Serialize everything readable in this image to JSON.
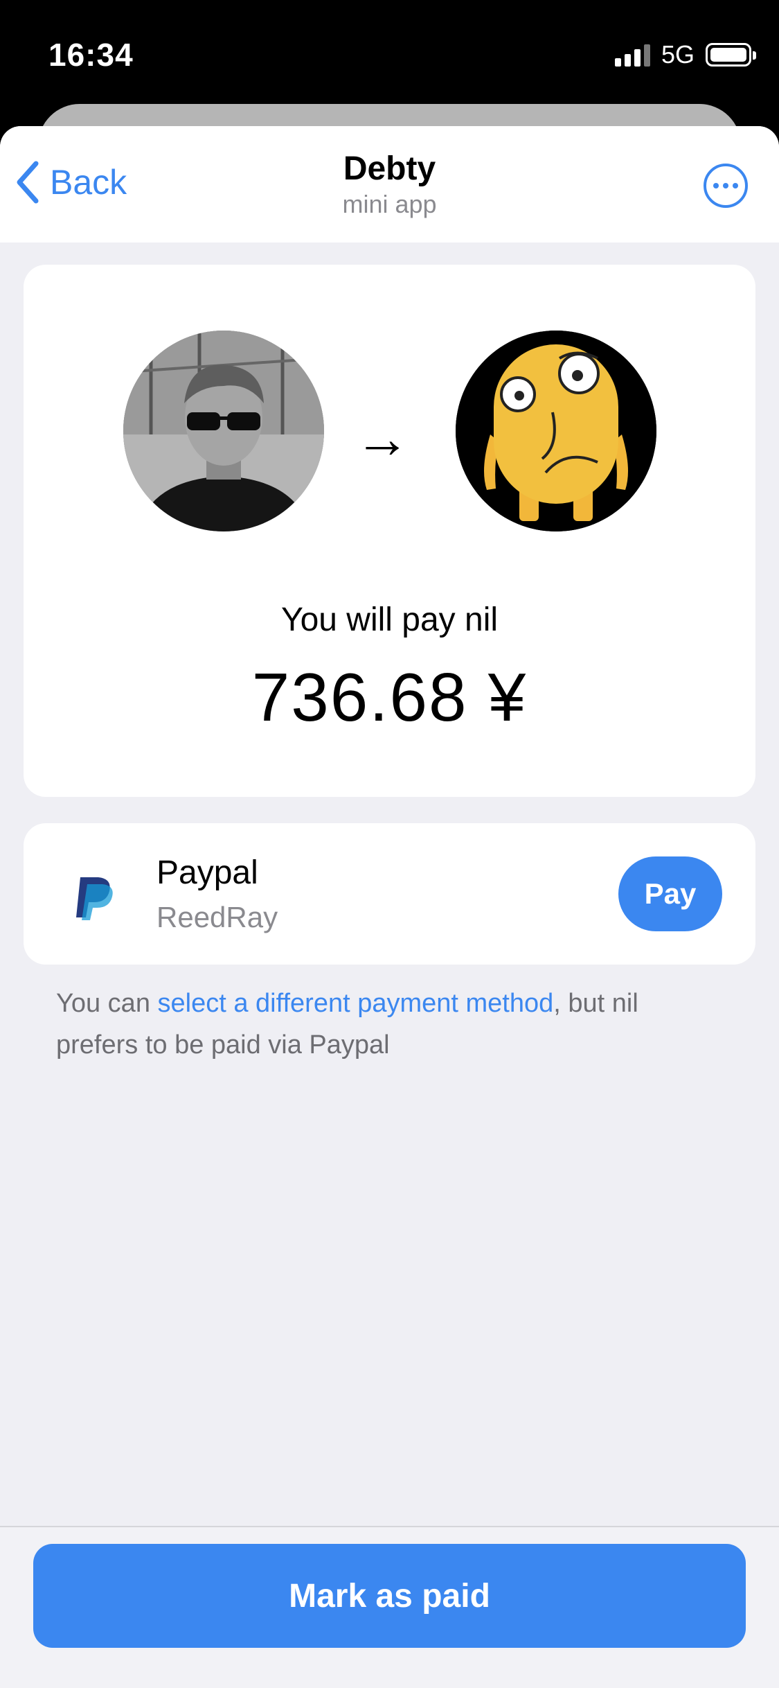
{
  "status_bar": {
    "time": "16:34",
    "network": "5G",
    "signal_bars": 3,
    "battery_level": 1.0
  },
  "nav": {
    "back_label": "Back",
    "title": "Debty",
    "subtitle": "mini app",
    "more_icon": "ellipsis-circle-icon",
    "back_icon": "chevron-left-icon"
  },
  "payment": {
    "arrow": "→",
    "label": "You will pay nil",
    "amount": "736.68 ¥",
    "from_avatar": "avatar-man-sunglasses",
    "to_avatar": "avatar-yellow-cartoon"
  },
  "method": {
    "icon": "paypal-icon",
    "name": "Paypal",
    "username": "ReedRay",
    "pay_label": "Pay"
  },
  "hint": {
    "prefix": "You can ",
    "link": "select a different payment method",
    "suffix": ", but nil prefers to be paid via Paypal"
  },
  "footer": {
    "mark_paid_label": "Mark as paid"
  },
  "colors": {
    "accent": "#3b87f0",
    "background": "#efeff4",
    "secondary_text": "#8a8a8f"
  }
}
